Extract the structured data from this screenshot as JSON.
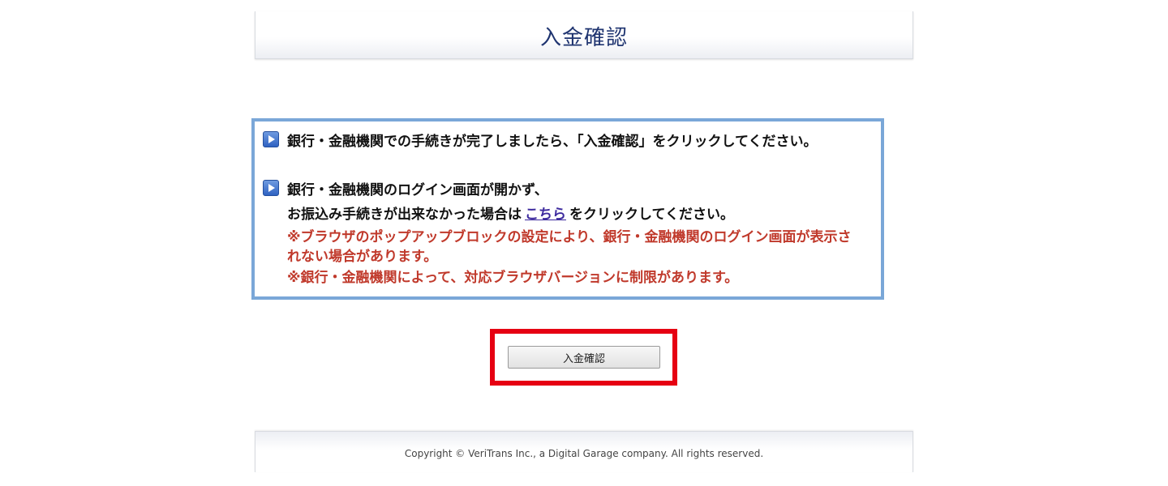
{
  "header": {
    "title": "入金確認"
  },
  "info": {
    "item1": {
      "icon": "play-arrow-icon",
      "text": "銀行・金融機関での手続きが完了しましたら、「入金確認」をクリックしてください。"
    },
    "item2": {
      "icon": "play-arrow-icon",
      "line1": "銀行・金融機関のログイン画面が開かず、",
      "line2_before": "お振込み手続きが出来なかった場合は",
      "link": "こちら",
      "line2_after": "をクリックしてください。"
    },
    "warnings": [
      "※ブラウザのポップアップブロックの設定により、銀行・金融機関のログイン画面が表示されない場合があります。",
      "※銀行・金融機関によって、対応ブラウザバージョンに制限があります。"
    ]
  },
  "actions": {
    "confirm_label": "入金確認"
  },
  "footer": {
    "copyright": "Copyright © VeriTrans Inc., a Digital Garage company. All rights reserved."
  },
  "colors": {
    "title": "#1f3470",
    "info_border": "#7aa7d8",
    "warning": "#c0392b",
    "link": "#3d2a9e",
    "highlight_frame": "#e60012"
  }
}
